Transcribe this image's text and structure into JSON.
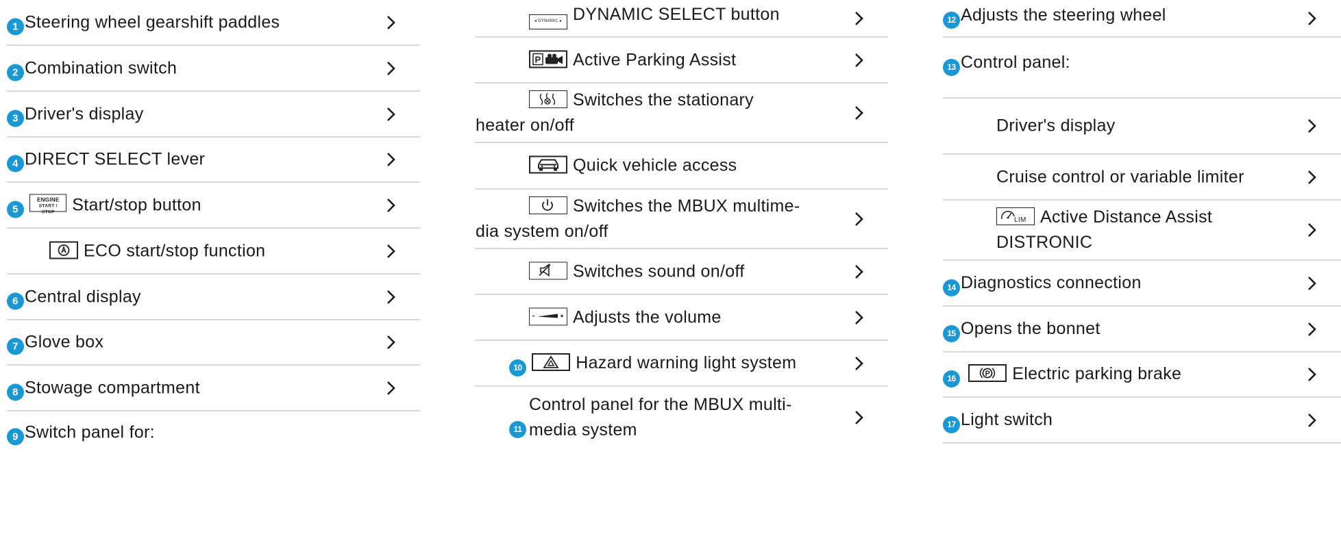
{
  "columns": [
    {
      "items": [
        {
          "num": "1",
          "label": "Steering wheel gearshift paddles",
          "chevron": true
        },
        {
          "num": "2",
          "label": "Combination switch",
          "chevron": true
        },
        {
          "num": "3",
          "label": "Driver's display",
          "chevron": true
        },
        {
          "num": "4",
          "label": "DIRECT SELECT lever",
          "chevron": true
        },
        {
          "num": "5",
          "icon": "engine-start-stop-key-icon",
          "icon_text_top": "ENGINE",
          "icon_text_bottom": "START / STOP",
          "label": "Start/stop button",
          "chevron": true
        },
        {
          "icon": "eco-start-stop-icon",
          "label": "ECO start/stop function",
          "chevron": true
        },
        {
          "num": "6",
          "label": "Central display",
          "chevron": true
        },
        {
          "num": "7",
          "label": "Glove box",
          "chevron": true
        },
        {
          "num": "8",
          "label": "Stowage compartment",
          "chevron": true
        },
        {
          "num": "9",
          "label": "Switch panel for:",
          "chevron": false
        }
      ]
    },
    {
      "items": [
        {
          "icon": "dynamic-select-icon",
          "icon_text": "DYNAMIC",
          "label": "DYNAMIC SELECT button",
          "chevron": true
        },
        {
          "icon": "active-parking-assist-icon",
          "label": "Active Parking Assist",
          "chevron": true
        },
        {
          "icon": "stationary-heater-icon",
          "label": "Switches the stationary",
          "label2": "heater on/off",
          "chevron": true
        },
        {
          "icon": "quick-vehicle-access-icon",
          "label": "Quick vehicle access",
          "chevron": false
        },
        {
          "icon": "power-icon",
          "label": "Switches the MBUX multime-",
          "label2": "dia system on/off",
          "chevron": true
        },
        {
          "icon": "sound-mute-icon",
          "label": "Switches sound on/off",
          "chevron": true
        },
        {
          "icon": "volume-icon",
          "label": "Adjusts the volume",
          "chevron": true
        },
        {
          "num": "10",
          "icon": "hazard-warning-icon",
          "label": "Hazard warning light system",
          "chevron": true
        },
        {
          "num": "11",
          "label": "Control panel for the MBUX multi-",
          "label2": "media system",
          "chevron": true
        }
      ]
    },
    {
      "items": [
        {
          "num": "12",
          "label": "Adjusts the steering wheel",
          "chevron": true
        },
        {
          "num": "13",
          "label": "Control panel:",
          "chevron": false
        },
        {
          "label": "Driver's display",
          "chevron": true
        },
        {
          "label": "Cruise control or variable limiter",
          "chevron": true
        },
        {
          "icon": "distronic-icon",
          "icon_text": "LIM",
          "label": "Active Distance Assist",
          "label2": "DISTRONIC",
          "chevron": true
        },
        {
          "num": "14",
          "label": "Diagnostics connection",
          "chevron": true
        },
        {
          "num": "15",
          "label": "Opens the bonnet",
          "chevron": true
        },
        {
          "num": "16",
          "icon": "electric-parking-brake-icon",
          "label": "Electric parking brake",
          "chevron": true
        },
        {
          "num": "17",
          "label": "Light switch",
          "chevron": true
        }
      ]
    }
  ],
  "colors": {
    "accent": "#1998d5",
    "divider": "#d9d9d9",
    "text": "#1a1a1a"
  }
}
